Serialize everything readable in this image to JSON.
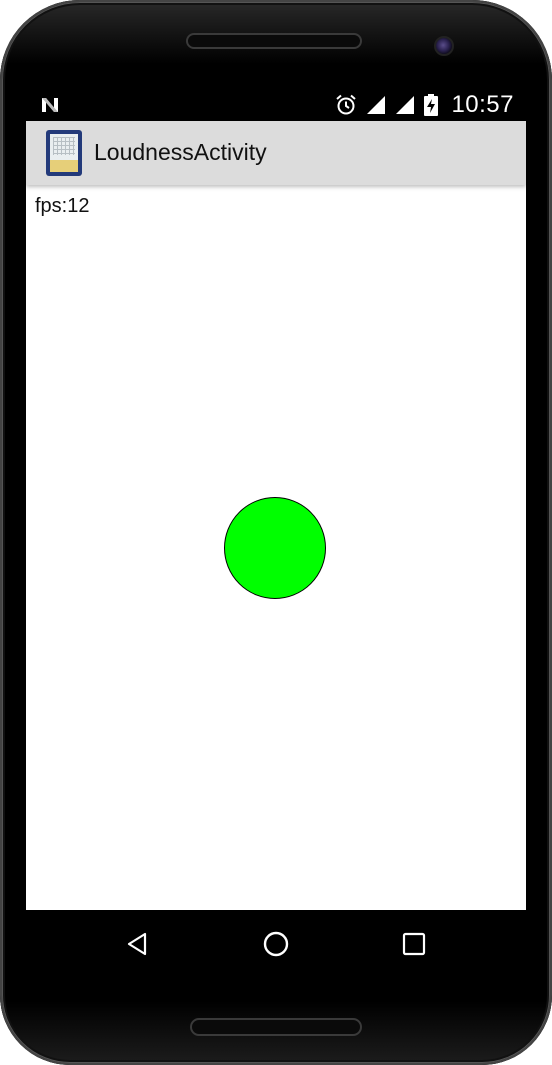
{
  "status_bar": {
    "time": "10:57",
    "icons": [
      "notification-n-icon",
      "alarm-icon",
      "signal-icon",
      "signal-icon",
      "battery-charging-icon"
    ]
  },
  "action_bar": {
    "title": "LoudnessActivity",
    "icon": "app-icon"
  },
  "content": {
    "fps_label": "fps:12",
    "ball_color": "#00ff00"
  },
  "nav_bar": {
    "buttons": [
      "back-icon",
      "home-icon",
      "recents-icon"
    ]
  },
  "colors": {
    "action_bar_bg": "#dcdcdc",
    "status_bar_bg": "#000000",
    "nav_bar_bg": "#000000"
  }
}
